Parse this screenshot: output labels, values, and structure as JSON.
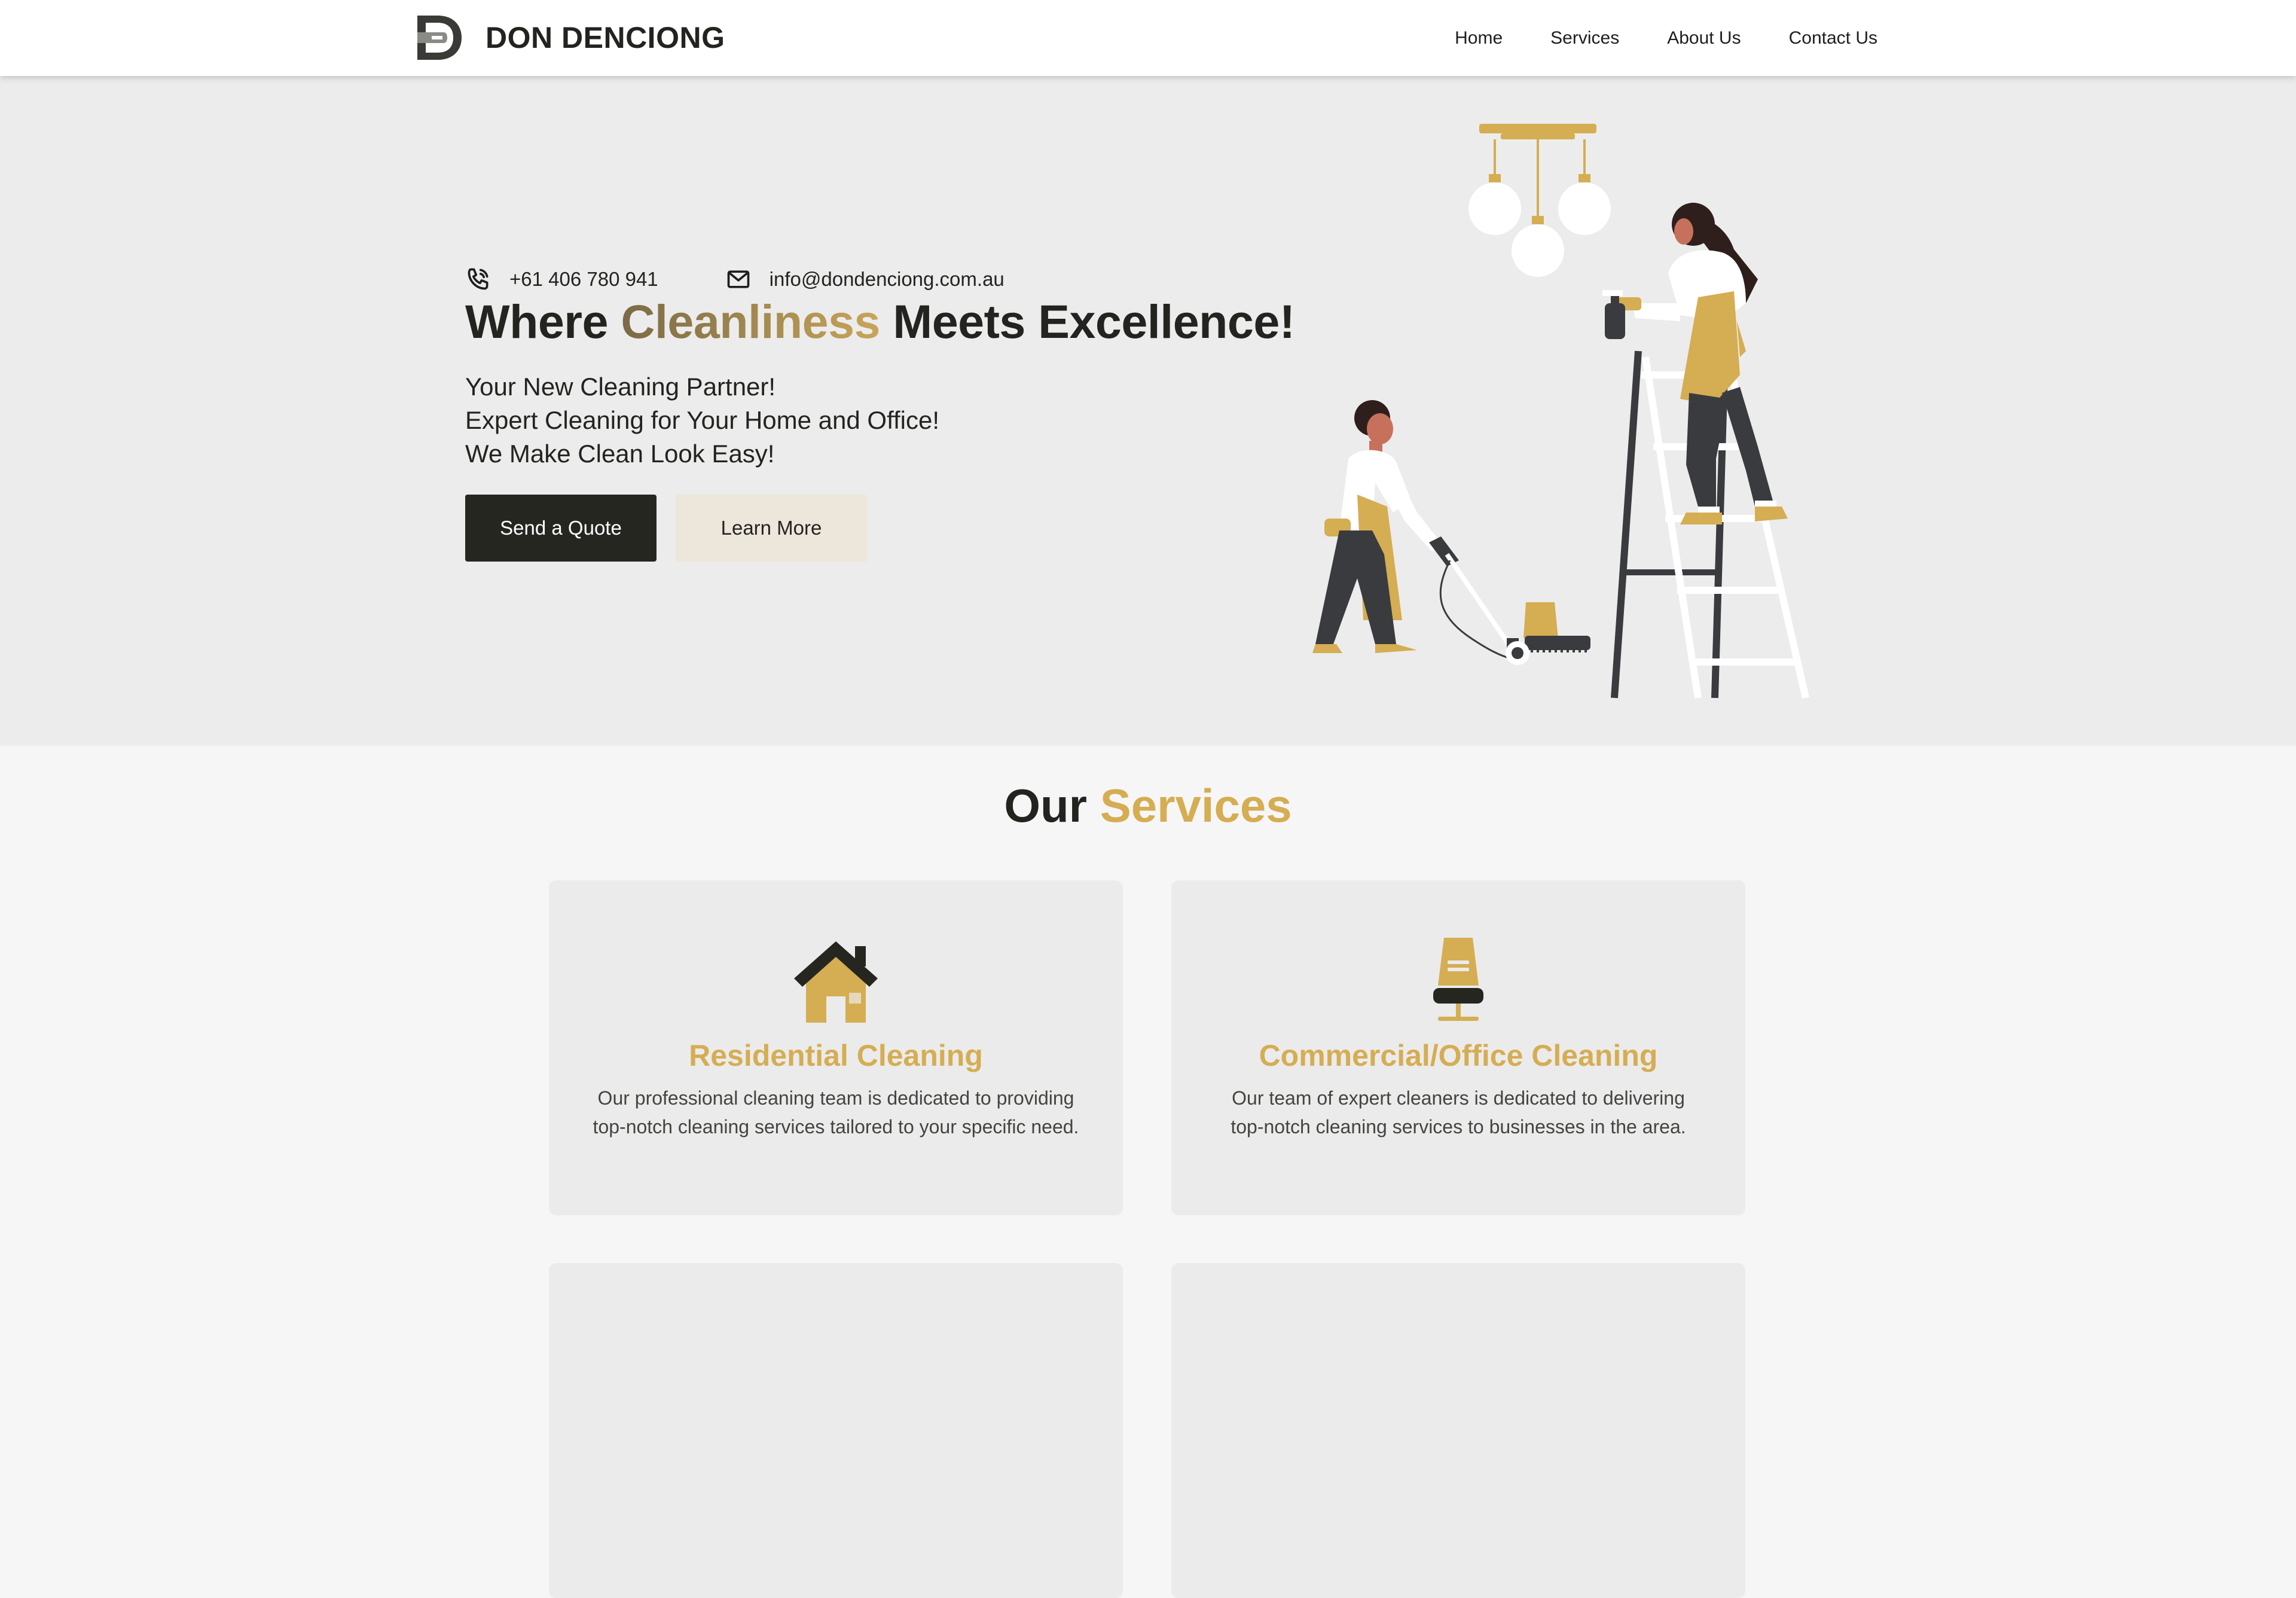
{
  "header": {
    "brand_name": "DON DENCIONG",
    "nav": [
      "Home",
      "Services",
      "About Us",
      "Contact Us"
    ]
  },
  "hero": {
    "phone": "+61 406 780 941",
    "email": "info@dondenciong.com.au",
    "title_before": "Where ",
    "title_accent": "Cleanliness",
    "title_after": " Meets Excellence!",
    "lines": [
      "Your New Cleaning Partner!",
      "Expert Cleaning for Your Home and Office!",
      "We Make Clean Look Easy!"
    ],
    "primary_button": "Send a Quote",
    "secondary_button": "Learn More"
  },
  "services": {
    "title_before": "Our ",
    "title_accent": "Services",
    "cards": [
      {
        "icon": "house-icon",
        "title": "Residential Cleaning",
        "description": "Our professional cleaning team is dedicated to providing top-notch cleaning services tailored to your specific need."
      },
      {
        "icon": "office-chair-icon",
        "title": "Commercial/Office Cleaning",
        "description": "Our team of expert cleaners is dedicated to delivering top-notch cleaning services to businesses in the area."
      }
    ]
  },
  "colors": {
    "accent": "#d5ad52",
    "dark": "#23231f",
    "hero_bg": "#ececec",
    "card_bg": "#ebebeb"
  }
}
